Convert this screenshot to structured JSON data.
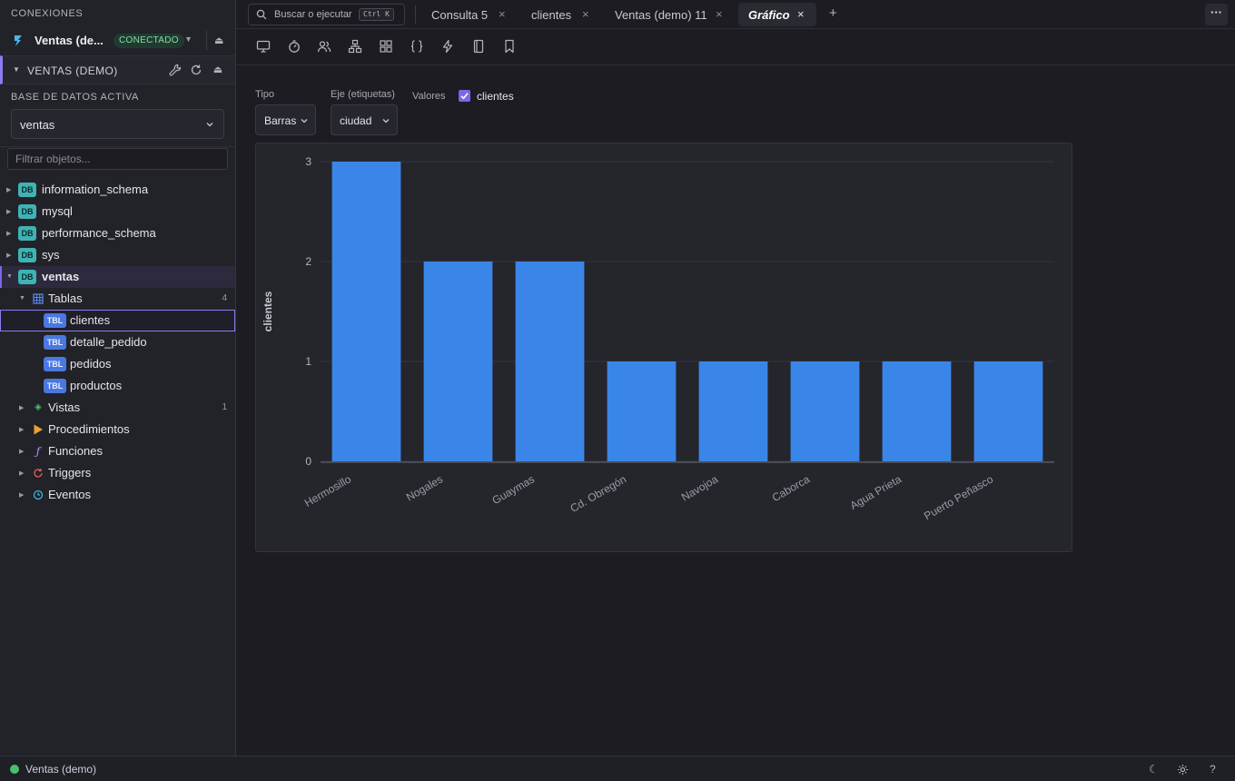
{
  "sidebar": {
    "title": "CONEXIONES",
    "connection": {
      "name": "Ventas (de...",
      "status": "CONECTADO"
    },
    "db_section": {
      "label": "VENTAS (DEMO)"
    },
    "active_db": {
      "label": "BASE DE DATOS ACTIVA",
      "value": "ventas"
    },
    "filter": {
      "placeholder": "Filtrar objetos..."
    },
    "databases": [
      {
        "tag": "DB",
        "name": "information_schema"
      },
      {
        "tag": "DB",
        "name": "mysql"
      },
      {
        "tag": "DB",
        "name": "performance_schema"
      },
      {
        "tag": "DB",
        "name": "sys"
      },
      {
        "tag": "DB",
        "name": "ventas"
      }
    ],
    "groups": {
      "tablas": {
        "label": "Tablas",
        "count": "4"
      },
      "vistas": {
        "label": "Vistas",
        "count": "1"
      },
      "procedimientos": {
        "label": "Procedimientos"
      },
      "funciones": {
        "label": "Funciones"
      },
      "triggers": {
        "label": "Triggers"
      },
      "eventos": {
        "label": "Eventos"
      }
    },
    "tables": [
      {
        "tag": "TBL",
        "name": "clientes"
      },
      {
        "tag": "TBL",
        "name": "detalle_pedido"
      },
      {
        "tag": "TBL",
        "name": "pedidos"
      },
      {
        "tag": "TBL",
        "name": "productos"
      }
    ]
  },
  "tabs": {
    "search_placeholder": "Buscar o ejecutar",
    "search_shortcut": "Ctrl K",
    "items": [
      {
        "label": "Consulta 5"
      },
      {
        "label": "clientes"
      },
      {
        "label": "Ventas (demo) 11"
      },
      {
        "label": "Gráfico"
      }
    ],
    "close_glyph": "×",
    "add_glyph": "+",
    "more_glyph": "···"
  },
  "toolbar": {
    "icons": [
      "monitor-icon",
      "timer-icon",
      "users-icon",
      "hierarchy-icon",
      "grid-icon",
      "braces-icon",
      "lightning-icon",
      "notebook-icon",
      "bookmark-icon"
    ]
  },
  "chart_config": {
    "tipo_label": "Tipo",
    "tipo_value": "Barras",
    "eje_label": "Eje (etiquetas)",
    "eje_value": "ciudad",
    "valores_label": "Valores",
    "valores_checked_series": "clientes"
  },
  "chart_data": {
    "type": "bar",
    "categories": [
      "Hermosillo",
      "Nogales",
      "Guaymas",
      "Cd. Obregón",
      "Navojoa",
      "Caborca",
      "Agua Prieta",
      "Puerto Peñasco"
    ],
    "series": [
      {
        "name": "clientes",
        "values": [
          3,
          2,
          2,
          1,
          1,
          1,
          1,
          1
        ]
      }
    ],
    "ylabel": "clientes",
    "xlabel": "",
    "ylim": [
      0,
      3
    ],
    "yticks": [
      0,
      1,
      2,
      3
    ],
    "bar_color": "#3a86e8",
    "grid": true
  },
  "statusbar": {
    "connection_label": "Ventas (demo)",
    "status_color": "#47c16b"
  },
  "colors": {
    "accent": "#7a68e6",
    "background": "#1c1c22",
    "sidebar": "#222229"
  }
}
